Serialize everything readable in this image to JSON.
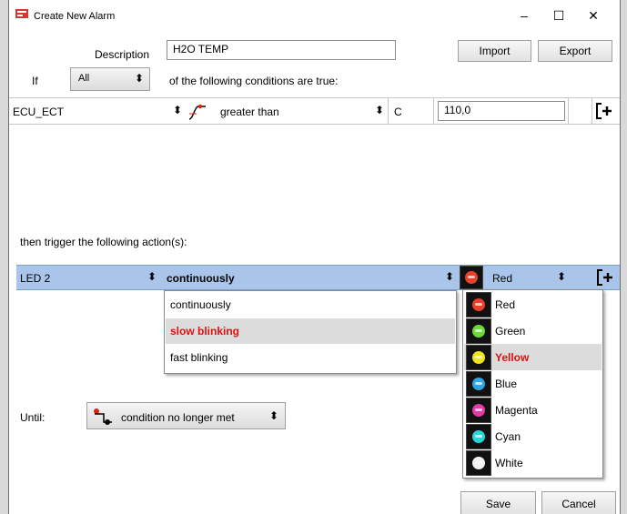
{
  "window": {
    "title": "Create New Alarm",
    "minimize": "–",
    "maximize": "☐",
    "close": "✕"
  },
  "description": {
    "label": "Description",
    "value": "H2O TEMP"
  },
  "buttons": {
    "import": "Import",
    "export": "Export",
    "save": "Save",
    "cancel": "Cancel"
  },
  "condition_header": {
    "if_label": "If",
    "mode": "All",
    "text": "of the following conditions are true:"
  },
  "condition": {
    "channel": "ECU_ECT",
    "operator": "greater than",
    "unit": "C",
    "value": "110,0"
  },
  "action_header": "then trigger the following action(s):",
  "action": {
    "output": "LED 2",
    "mode": "continuously",
    "color": "Red"
  },
  "mode_options": [
    "continuously",
    "slow blinking",
    "fast blinking"
  ],
  "mode_highlighted": "slow blinking",
  "color_options": [
    {
      "name": "Red",
      "hex": "#e8402a"
    },
    {
      "name": "Green",
      "hex": "#6cd93a"
    },
    {
      "name": "Yellow",
      "hex": "#f1e31a"
    },
    {
      "name": "Blue",
      "hex": "#2ea6e6"
    },
    {
      "name": "Magenta",
      "hex": "#e23aa6"
    },
    {
      "name": "Cyan",
      "hex": "#25d5d8"
    },
    {
      "name": "White",
      "hex": "#f2f2f2"
    }
  ],
  "color_highlighted": "Yellow",
  "until": {
    "label": "Until:",
    "value": "condition no longer met"
  },
  "colors": {
    "action_row": "#a9c6ea",
    "highlight_text": "#e01010"
  }
}
